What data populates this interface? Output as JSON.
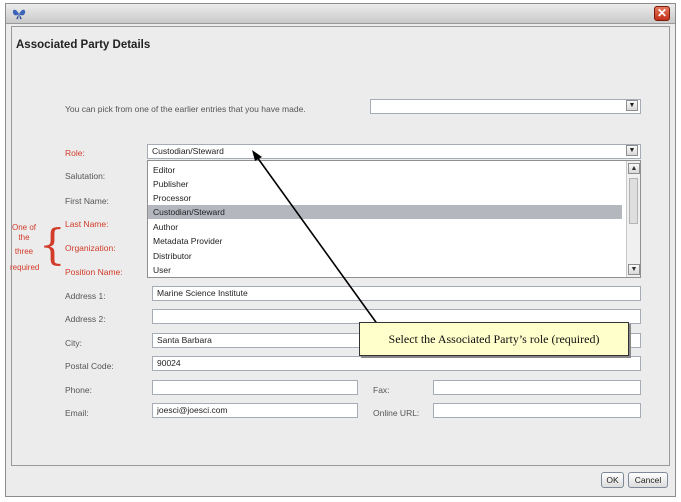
{
  "window": {
    "close_glyph": "✕"
  },
  "heading": "Associated Party Details",
  "picker": {
    "prompt": "You can pick from one of the earlier entries that you have made.",
    "value": ""
  },
  "labels": {
    "role": "Role:",
    "salutation": "Salutation:",
    "first_name": "First Name:",
    "last_name": "Last Name:",
    "organization": "Organization:",
    "position_name": "Position Name:",
    "address1": "Address 1:",
    "address2": "Address 2:",
    "city": "City:",
    "postal_code": "Postal Code:",
    "phone": "Phone:",
    "fax": "Fax:",
    "email": "Email:",
    "online_url": "Online URL:"
  },
  "required_note": {
    "line1": "One of",
    "line2": "the",
    "line3": "three",
    "line4": "required"
  },
  "role": {
    "value": "Custodian/Steward",
    "options": [
      "Editor",
      "Publisher",
      "Processor",
      "Custodian/Steward",
      "Author",
      "Metadata Provider",
      "Distributor",
      "User"
    ],
    "selected": "Custodian/Steward"
  },
  "values": {
    "address1": "Marine Science Institute",
    "address2": "",
    "city": "Santa Barbara",
    "postal_code": "90024",
    "phone": "",
    "fax": "",
    "email": "joesci@joesci.com",
    "online_url": ""
  },
  "callout": "Select the Associated Party’s role (required)",
  "buttons": {
    "ok": "OK",
    "cancel": "Cancel"
  },
  "icons": {
    "app": "butterfly-icon",
    "dropdown": "chevron-down-icon",
    "scroll_up": "chevron-up-icon",
    "close": "close-icon"
  },
  "colors": {
    "required_label": "#d23a2a",
    "callout_bg": "#ffffcc",
    "close_button": "#c2301a",
    "selected_item": "#b5b7bf"
  }
}
